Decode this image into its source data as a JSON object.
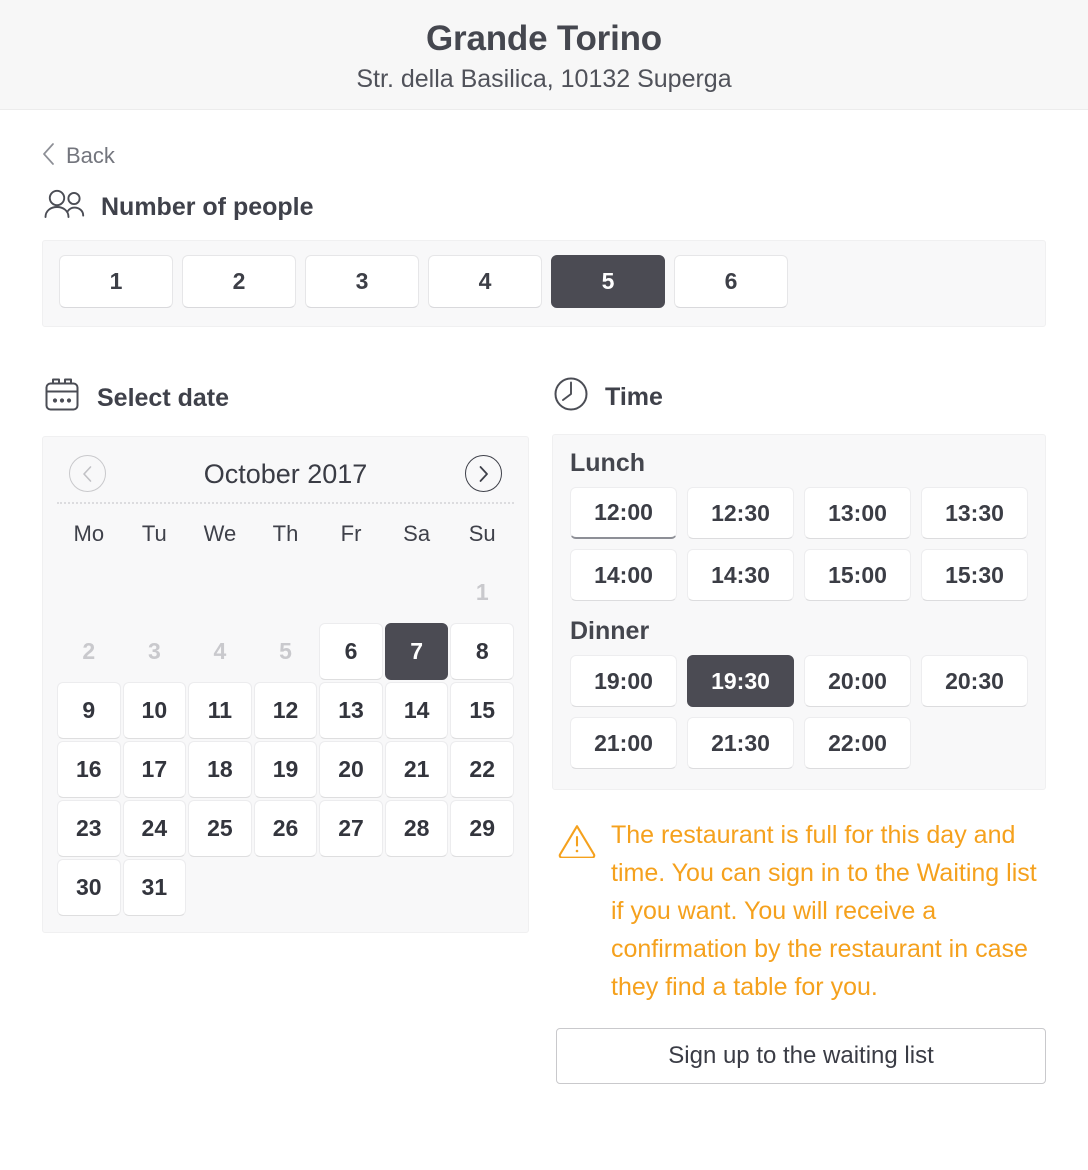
{
  "header": {
    "title": "Grande Torino",
    "subtitle": "Str. della Basilica, 10132 Superga"
  },
  "nav": {
    "back_label": "Back"
  },
  "people": {
    "heading": "Number of people",
    "icon": "people-icon",
    "options": [
      "1",
      "2",
      "3",
      "4",
      "5",
      "6"
    ],
    "selected": "5"
  },
  "date": {
    "heading": "Select date",
    "icon": "calendar-icon",
    "month_label": "October 2017",
    "prev_icon": "chevron-left-circle-icon",
    "next_icon": "chevron-right-circle-icon",
    "prev_enabled": false,
    "next_enabled": true,
    "weekdays": [
      "Mo",
      "Tu",
      "We",
      "Th",
      "Fr",
      "Sa",
      "Su"
    ],
    "leading_blanks": 6,
    "cells": [
      {
        "day": "1",
        "state": "disabled"
      },
      {
        "day": "2",
        "state": "disabled"
      },
      {
        "day": "3",
        "state": "disabled"
      },
      {
        "day": "4",
        "state": "disabled"
      },
      {
        "day": "5",
        "state": "disabled"
      },
      {
        "day": "6",
        "state": "avail"
      },
      {
        "day": "7",
        "state": "selected"
      },
      {
        "day": "8",
        "state": "avail"
      },
      {
        "day": "9",
        "state": "avail"
      },
      {
        "day": "10",
        "state": "avail"
      },
      {
        "day": "11",
        "state": "avail"
      },
      {
        "day": "12",
        "state": "avail"
      },
      {
        "day": "13",
        "state": "avail"
      },
      {
        "day": "14",
        "state": "avail"
      },
      {
        "day": "15",
        "state": "avail"
      },
      {
        "day": "16",
        "state": "avail"
      },
      {
        "day": "17",
        "state": "avail"
      },
      {
        "day": "18",
        "state": "avail"
      },
      {
        "day": "19",
        "state": "avail"
      },
      {
        "day": "20",
        "state": "avail"
      },
      {
        "day": "21",
        "state": "avail"
      },
      {
        "day": "22",
        "state": "avail"
      },
      {
        "day": "23",
        "state": "avail"
      },
      {
        "day": "24",
        "state": "avail"
      },
      {
        "day": "25",
        "state": "avail"
      },
      {
        "day": "26",
        "state": "avail"
      },
      {
        "day": "27",
        "state": "avail"
      },
      {
        "day": "28",
        "state": "avail"
      },
      {
        "day": "29",
        "state": "avail"
      },
      {
        "day": "30",
        "state": "avail"
      },
      {
        "day": "31",
        "state": "avail"
      }
    ],
    "selected_day": "7"
  },
  "time": {
    "heading": "Time",
    "icon": "clock-icon",
    "groups": [
      {
        "label": "Lunch",
        "slots": [
          {
            "time": "12:00",
            "state": "focus"
          },
          {
            "time": "12:30",
            "state": "avail"
          },
          {
            "time": "13:00",
            "state": "avail"
          },
          {
            "time": "13:30",
            "state": "avail"
          },
          {
            "time": "14:00",
            "state": "avail"
          },
          {
            "time": "14:30",
            "state": "avail"
          },
          {
            "time": "15:00",
            "state": "avail"
          },
          {
            "time": "15:30",
            "state": "avail"
          }
        ]
      },
      {
        "label": "Dinner",
        "slots": [
          {
            "time": "19:00",
            "state": "avail"
          },
          {
            "time": "19:30",
            "state": "selected"
          },
          {
            "time": "20:00",
            "state": "avail"
          },
          {
            "time": "20:30",
            "state": "avail"
          },
          {
            "time": "21:00",
            "state": "avail"
          },
          {
            "time": "21:30",
            "state": "avail"
          },
          {
            "time": "22:00",
            "state": "avail"
          }
        ]
      }
    ],
    "selected_time": "19:30"
  },
  "warning": {
    "icon": "warning-triangle-icon",
    "message": "The restaurant is full for this day and time. You can sign in to the Waiting list if you want. You will receive a confirmation by the restaurant in case they find a table for you.",
    "color": "#f5a11d"
  },
  "cta": {
    "waiting_list_label": "Sign up to the waiting list"
  },
  "colors": {
    "selected_fill": "#4b4b53",
    "panel_bg": "#f8f8f9",
    "header_bg": "#f7f7f7",
    "text": "#3f414a",
    "muted": "#c9c9cd",
    "warning": "#f5a11d"
  }
}
